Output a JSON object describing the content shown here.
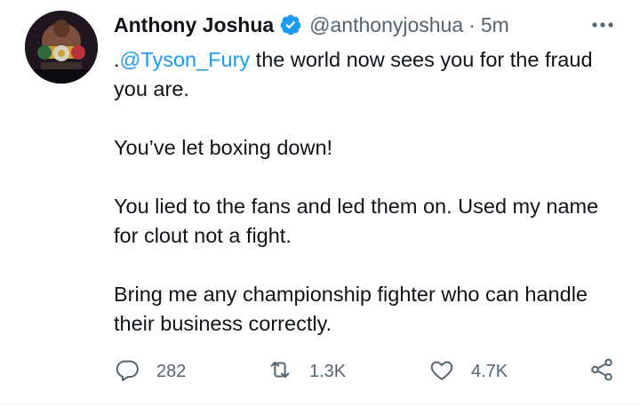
{
  "author": {
    "name": "Anthony Joshua",
    "handle": "@anthonyjoshua",
    "separator": "·",
    "time": "5m",
    "verified_color": "#1d9bf0"
  },
  "tweet": {
    "mention_prefix": ".",
    "mention": "@Tyson_Fury",
    "line1_rest": " the world now sees you for the fraud you are.",
    "para2": "You’ve let boxing down!",
    "para3": "You lied to the fans and led them on. Used my name for clout not a fight.",
    "para4": "Bring me any championship fighter who can handle their business correctly."
  },
  "actions": {
    "reply_count": "282",
    "retweet_count": "1.3K",
    "like_count": "4.7K"
  },
  "icons": {
    "reply": "comment-bubble-icon",
    "retweet": "retweet-arrows-icon",
    "like": "heart-icon",
    "share": "share-icon",
    "more": "more-dots-icon"
  },
  "colors": {
    "accent": "#1d9bf0",
    "text": "#0f1419",
    "muted": "#536471"
  }
}
